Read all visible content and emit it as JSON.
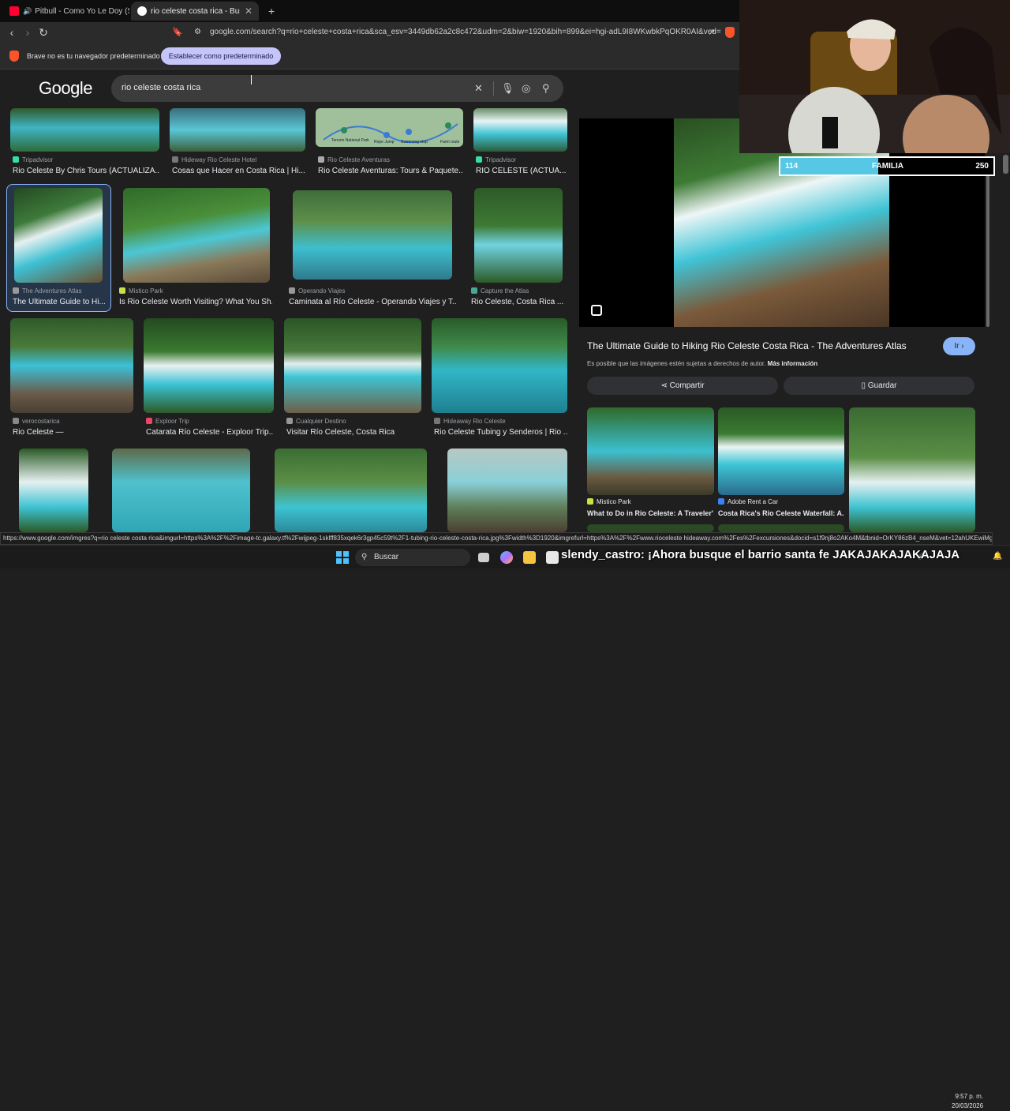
{
  "browser": {
    "tabs": [
      {
        "label": "Pitbull - Como Yo Le Doy (Spang",
        "audio_icon": "speaker-icon",
        "active": false
      },
      {
        "label": "rio celeste costa rica - Buscar co",
        "active": true
      }
    ],
    "new_tab": "+",
    "url": "google.com/search?q=rio+celeste+costa+rica&sca_esv=3449db62a2c8c472&udm=2&biw=1920&bih=899&ei=hgi-adL9I8WKwbkPqOKR0AI&ved=0...",
    "infobar_message": "Brave no es tu navegador predeterminado",
    "infobar_button": "Establecer como predeterminado"
  },
  "google": {
    "logo": "Google",
    "query": "rio celeste costa rica"
  },
  "results": {
    "row1": [
      {
        "source": "Tripadvisor",
        "title": "Rio Celeste By Chris Tours (ACTUALIZA..."
      },
      {
        "source": "Hideway Rio Celeste Hotel",
        "title": "Cosas que Hacer en Costa Rica | Hi..."
      },
      {
        "source": "Rio Celeste Aventuras",
        "title": "Rio Celeste Aventuras: Tours & Paquete..."
      },
      {
        "source": "Tripadvisor",
        "title": "RIO CELESTE (ACTUA..."
      }
    ],
    "map_labels": [
      "Tenorio National Park",
      "Rope Jump",
      "Swimming stop",
      "Farm route"
    ],
    "row2": [
      {
        "source": "The Adventures Atlas",
        "title": "The Ultimate Guide to Hi..."
      },
      {
        "source": "Mistico Park",
        "title": "Is Rio Celeste Worth Visiting? What You Sh..."
      },
      {
        "source": "Operando Viajes",
        "title": "Caminata al Río Celeste - Operando Viajes y T..."
      },
      {
        "source": "Capture the Atlas",
        "title": "Rio Celeste, Costa Rica ..."
      }
    ],
    "row3": [
      {
        "source": "verocostarica",
        "title": "Rio Celeste —"
      },
      {
        "source": "Exploor Trip",
        "title": "Catarata Río Celeste - Exploor Trip..."
      },
      {
        "source": "Cualquier Destino",
        "title": "Visitar Río Celeste, Costa Rica"
      },
      {
        "source": "Hideaway Rio Celeste",
        "title": "Rio Celeste Tubing y Senderos | Rio ..."
      }
    ]
  },
  "panel": {
    "title": "The Ultimate Guide to Hiking Rio Celeste Costa Rica - The Adventures Atlas",
    "go_button": "Ir",
    "copyright_note": "Es posible que las imágenes estén sujetas a derechos de autor.",
    "more_info": "Más información",
    "share": "Compartir",
    "save": "Guardar",
    "related": [
      {
        "source": "Mistico Park",
        "title": "What to Do in Rio Celeste: A Traveler's..."
      },
      {
        "source": "Adobe Rent a Car",
        "title": "Costa Rica's Rio Celeste Waterfall: A..."
      }
    ]
  },
  "status_url": "https://www.google.com/imgres?q=rio celeste costa rica&imgurl=https%3A%2F%2Fimage-tc.galaxy.tf%2Fwijpeg-1sklff835xqek6r3gp45c59t%2F1-tubing-rio-celeste-costa-rica.jpg%3Fwidth%3D1920&imgrefurl=https%3A%2F%2Fwww.rioceleste hideaway.com%2Fes%2Fexcursiones&docid=s1f9nj8o2AKo4M&tbnid=OrKY86zB4_nseM&vet=12ahUKEwiMg...",
  "overlay": {
    "score_left": "114",
    "score_label": "FAMILIA",
    "score_right": "250",
    "score_fill_fraction": 0.46,
    "chat": "slendy_castro: ¡Ahora busque el barrio santa fe JAKAJAKAJAKAJAJA"
  },
  "taskbar": {
    "search": "Buscar",
    "time": "9:57 p. m.",
    "date": "20/03/2026"
  }
}
